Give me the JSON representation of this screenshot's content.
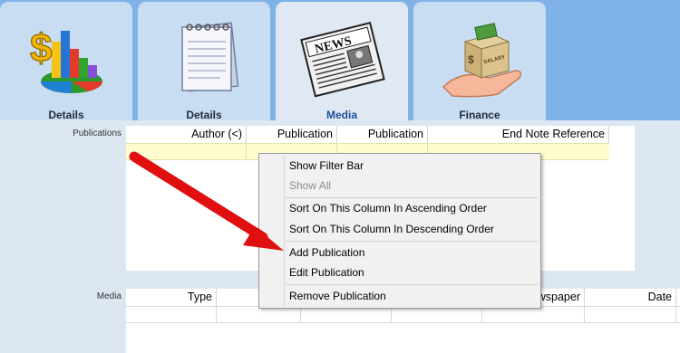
{
  "tabs": [
    {
      "label": "Details",
      "icon": "chart-money-icon",
      "active": false
    },
    {
      "label": "Details",
      "icon": "notepad-icon",
      "active": false
    },
    {
      "label": "Media",
      "icon": "newspaper-icon",
      "active": true
    },
    {
      "label": "Finance",
      "icon": "hand-money-box-icon",
      "active": false
    }
  ],
  "newspaper_text": "NEWS",
  "box_text": "SALARY",
  "publications": {
    "label": "Publications",
    "columns": [
      "Author (<)",
      "Publication",
      "Publication",
      "End Note Reference"
    ]
  },
  "media": {
    "label": "Media",
    "columns": [
      "Type",
      "",
      "",
      "Newspaper",
      "Date"
    ]
  },
  "context_menu": {
    "items": [
      {
        "label": "Show Filter Bar",
        "enabled": true
      },
      {
        "label": "Show All",
        "enabled": false
      },
      {
        "label": "Sort On This Column In Ascending Order",
        "enabled": true
      },
      {
        "label": "Sort On This Column In Descending Order",
        "enabled": true
      },
      {
        "label": "Add Publication",
        "enabled": true
      },
      {
        "label": "Edit Publication",
        "enabled": true
      },
      {
        "label": "Remove Publication",
        "enabled": true
      }
    ]
  },
  "colors": {
    "tabbar": "#7fb2e6",
    "tab": "#c9ddf2",
    "active_tab": "#dfe8f3",
    "filter_row": "#fffdd0",
    "arrow": "#e01010"
  }
}
